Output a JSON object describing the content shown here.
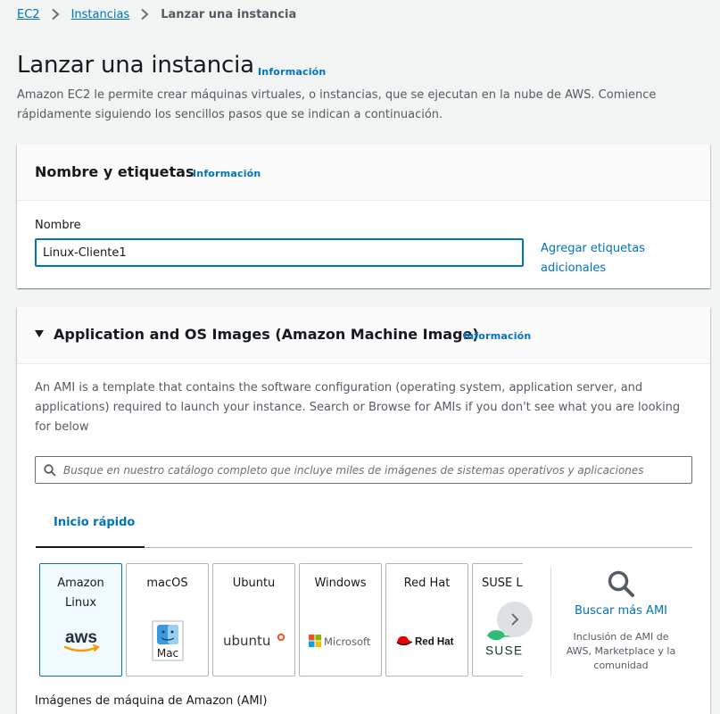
{
  "breadcrumb": {
    "items": [
      "EC2",
      "Instancias"
    ],
    "current": "Lanzar una instancia"
  },
  "header": {
    "title": "Lanzar una instancia",
    "info": "Información",
    "description": "Amazon EC2 le permite crear máquinas virtuales, o instancias, que se ejecutan en la nube de AWS. Comience rápidamente siguiendo los sencillos pasos que se indican a continuación."
  },
  "name_tags": {
    "title": "Nombre y etiquetas",
    "info": "Información",
    "field_label": "Nombre",
    "value": "Linux-Cliente1",
    "add_tags": "Agregar etiquetas adicionales"
  },
  "ami": {
    "title": "Application and OS Images (Amazon Machine Image)",
    "info": "Información",
    "description": "An AMI is a template that contains the software configuration (operating system, application server, and applications) required to launch your instance. Search or Browse for AMIs if you don't see what you are looking for below",
    "search_placeholder": "Busque en nuestro catálogo completo que incluye miles de imágenes de sistemas operativos y aplicaciones",
    "tab": "Inicio rápido",
    "cards": [
      {
        "label_line1": "Amazon",
        "label_line2": "Linux",
        "logo_text": "aws"
      },
      {
        "label_line1": "macOS",
        "logo_text": "Mac"
      },
      {
        "label_line1": "Ubuntu",
        "logo_text": "ubuntu"
      },
      {
        "label_line1": "Windows",
        "logo_text": "Microsoft"
      },
      {
        "label_line1": "Red Hat",
        "logo_text": "Red Hat"
      },
      {
        "label_line1": "SUSE Linux",
        "logo_text": "SUSE"
      }
    ],
    "browse_link": "Buscar más AMI",
    "browse_desc": "Inclusión de AMI de AWS, Marketplace y la comunidad",
    "subheading": "Imágenes de máquina de Amazon (AMI)"
  },
  "colors": {
    "link": "#0073bb",
    "background": "#f2f3f3",
    "aws_orange": "#ff9900",
    "redhat_red": "#ee0000",
    "ubuntu_orange": "#e95420",
    "suse_green": "#30ba78"
  }
}
